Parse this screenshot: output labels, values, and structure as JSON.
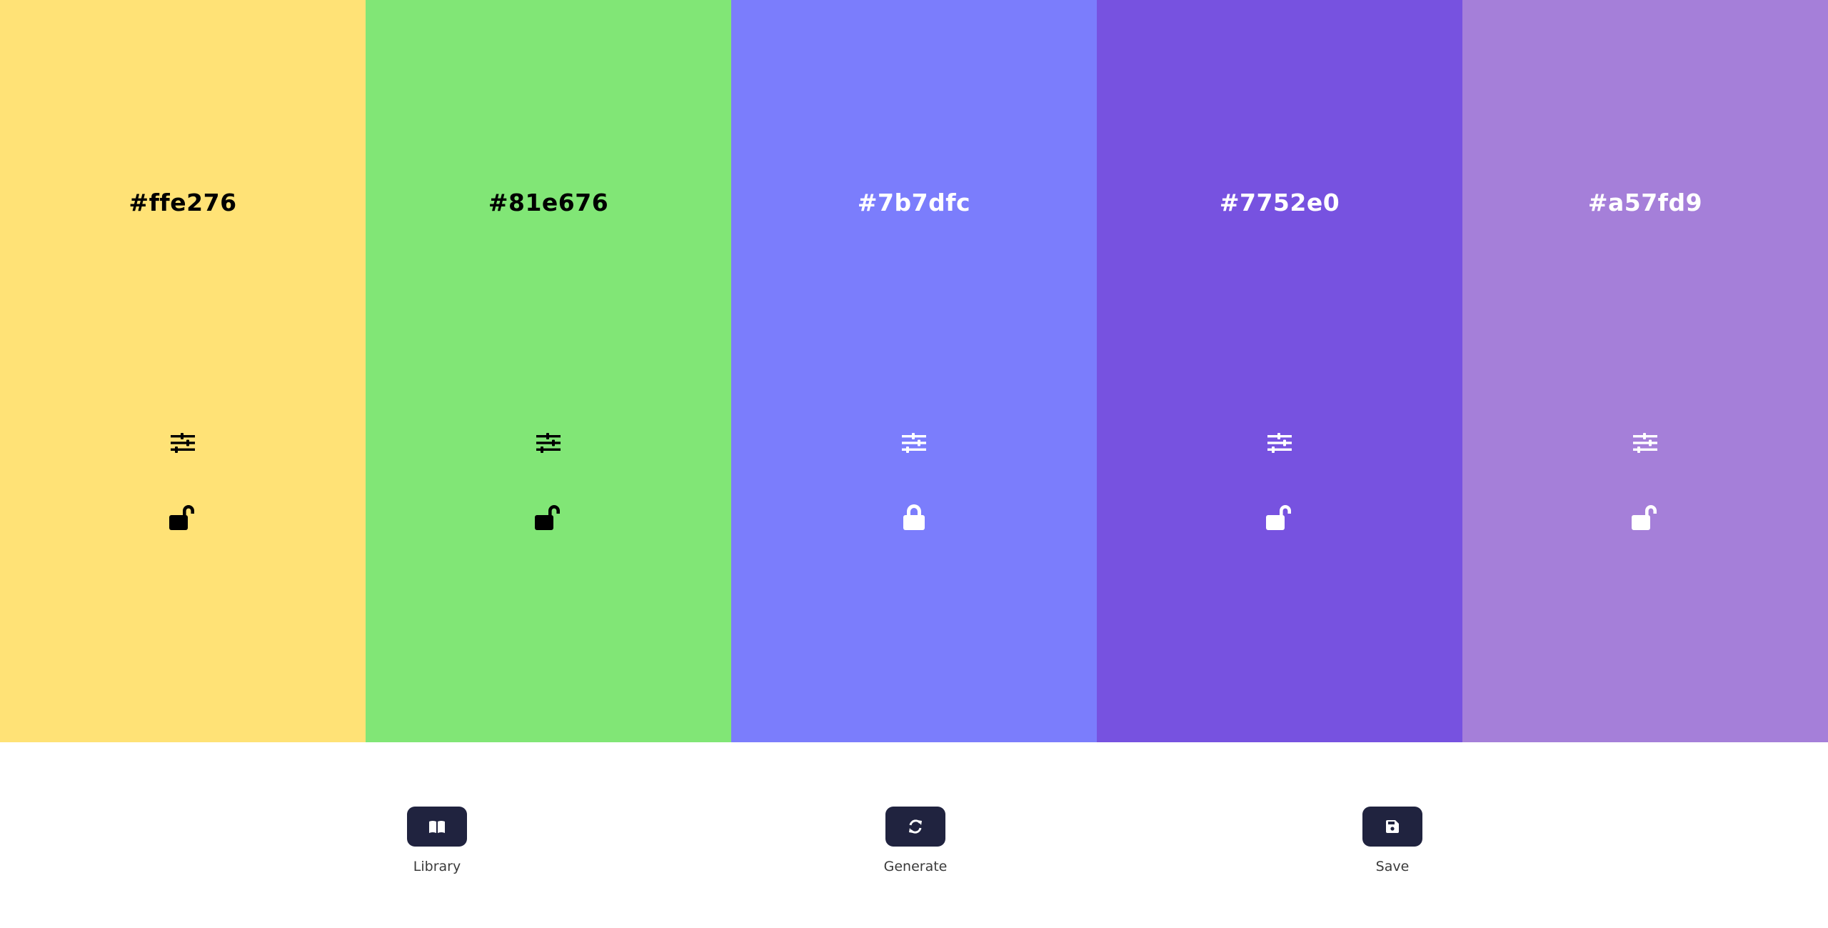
{
  "swatches": [
    {
      "hex": "#ffe276",
      "text_color": "#000000",
      "locked": false
    },
    {
      "hex": "#81e676",
      "text_color": "#000000",
      "locked": false
    },
    {
      "hex": "#7b7dfc",
      "text_color": "#ffffff",
      "locked": true
    },
    {
      "hex": "#7752e0",
      "text_color": "#ffffff",
      "locked": false
    },
    {
      "hex": "#a57fd9",
      "text_color": "#ffffff",
      "locked": false
    }
  ],
  "icons": {
    "adjust": "sliders-icon",
    "unlocked": "lock-open-icon",
    "locked": "lock-icon",
    "library": "book-open-icon",
    "generate": "refresh-icon",
    "save": "floppy-disk-icon"
  },
  "toolbar": {
    "button_color": "#20233f",
    "library_label": "Library",
    "generate_label": "Generate",
    "save_label": "Save"
  }
}
